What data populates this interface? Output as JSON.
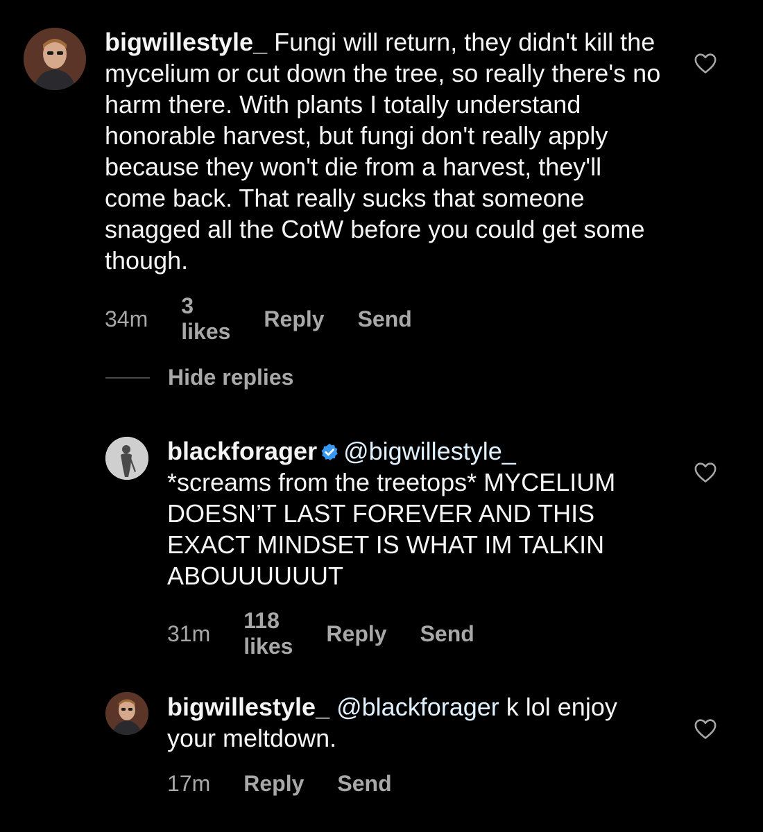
{
  "colors": {
    "background": "#000000",
    "text": "#f5f5f5",
    "meta": "#a8a8a8",
    "mention": "#e0f1ff",
    "verified": "#3897f0"
  },
  "comments": [
    {
      "username": "bigwillestyle_",
      "text": " Fungi will return, they didn't kill the mycelium or cut down the tree, so really there's no harm there. With plants I totally understand honorable harvest, but fungi don't really apply because they won't die from a harvest, they'll come back. That really sucks that someone snagged all the CotW before you could get some though.",
      "time": "34m",
      "likes": "3 likes",
      "reply_label": "Reply",
      "send_label": "Send",
      "icons": {
        "avatar": "avatar-man",
        "like": "heart-icon"
      }
    }
  ],
  "hide_replies_label": "Hide replies",
  "replies": [
    {
      "username": "blackforager",
      "verified_icon": "verified-badge-icon",
      "mention": "@bigwillestyle_",
      "text": "*screams from the treetops* MYCELIUM DOESN’T LAST FOREVER AND THIS EXACT MINDSET IS WHAT IM TALKIN ABOUUUUUUT",
      "time": "31m",
      "likes": "118 likes",
      "reply_label": "Reply",
      "send_label": "Send",
      "icons": {
        "avatar": "avatar-silhouette",
        "like": "heart-icon"
      }
    },
    {
      "username": "bigwillestyle_",
      "mention": "@blackforager",
      "text": " k lol enjoy your meltdown.",
      "time": "17m",
      "reply_label": "Reply",
      "send_label": "Send",
      "icons": {
        "avatar": "avatar-man",
        "like": "heart-icon"
      }
    }
  ]
}
